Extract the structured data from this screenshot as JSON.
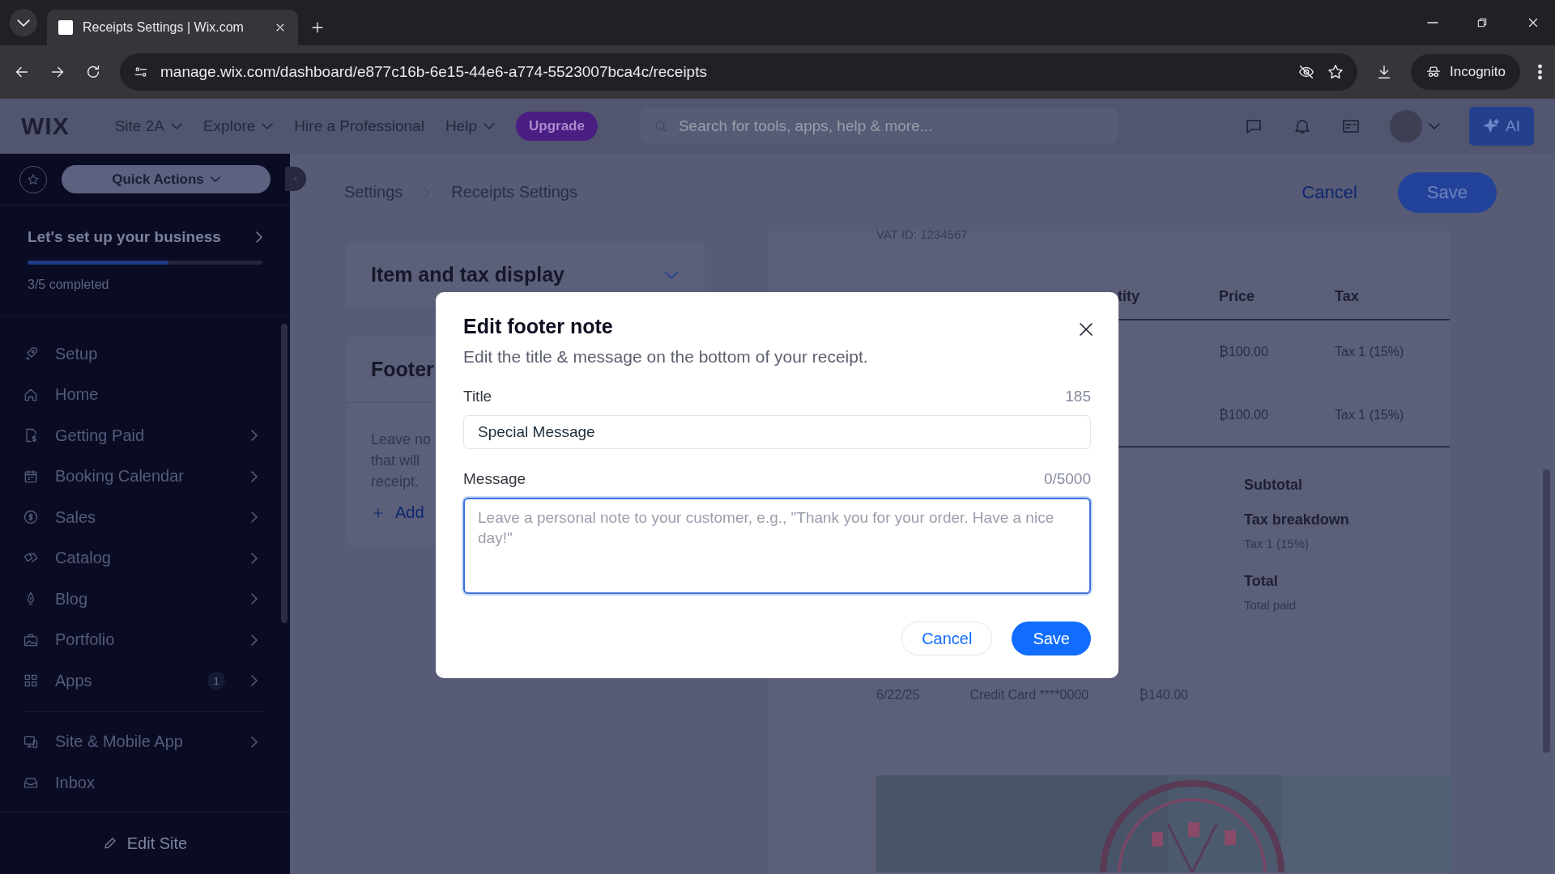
{
  "browser": {
    "tab_title": "Receipts Settings | Wix.com",
    "url": "manage.wix.com/dashboard/e877c16b-6e15-44e6-a774-5523007bca4c/receipts",
    "incognito": "Incognito"
  },
  "topbar": {
    "logo": "WIX",
    "menus": [
      {
        "label": "Site 2A",
        "dropdown": true
      },
      {
        "label": "Explore",
        "dropdown": true
      },
      {
        "label": "Hire a Professional",
        "dropdown": false
      },
      {
        "label": "Help",
        "dropdown": true
      }
    ],
    "upgrade": "Upgrade",
    "search_placeholder": "Search for tools, apps, help & more...",
    "ai": "AI"
  },
  "sidebar": {
    "quick_actions": "Quick Actions",
    "setup_title": "Let's set up your business",
    "setup_progress": {
      "level": 0.6
    },
    "setup_status": "3/5 completed",
    "items": [
      {
        "label": "Setup",
        "chevron": false
      },
      {
        "label": "Home",
        "chevron": false
      },
      {
        "label": "Getting Paid",
        "chevron": true
      },
      {
        "label": "Booking Calendar",
        "chevron": true
      },
      {
        "label": "Sales",
        "chevron": true
      },
      {
        "label": "Catalog",
        "chevron": true
      },
      {
        "label": "Blog",
        "chevron": true
      },
      {
        "label": "Portfolio",
        "chevron": true
      },
      {
        "label": "Apps",
        "chevron": true,
        "badge": "1"
      }
    ],
    "bottom_items": [
      {
        "label": "Site & Mobile App",
        "chevron": true
      },
      {
        "label": "Inbox",
        "chevron": false
      }
    ],
    "edit_site": "Edit Site"
  },
  "header": {
    "breadcrumbs": [
      "Settings",
      "Receipts Settings"
    ],
    "cancel": "Cancel",
    "save": "Save"
  },
  "settings": {
    "sections": [
      {
        "title": "Item and tax display"
      },
      {
        "title": "Footer",
        "lines": [
          "Leave no",
          "that will",
          "receipt."
        ],
        "add": "Add"
      }
    ]
  },
  "receipt": {
    "vat": "VAT ID: 1234567",
    "columns": [
      "tity",
      "Price",
      "Tax"
    ],
    "rows": [
      [
        "",
        "₿100.00",
        "Tax 1 (15%)"
      ],
      [
        "",
        "₿100.00",
        "Tax 1 (15%)"
      ]
    ],
    "summary": [
      {
        "label": "Subtotal"
      },
      {
        "label": "Tax breakdown",
        "note": "Tax 1 (15%)"
      },
      {
        "label": "Total",
        "note": "Total paid"
      }
    ],
    "payment": [
      "6/22/25",
      "Credit Card ****0000",
      "₿140.00"
    ]
  },
  "dialog": {
    "title": "Edit footer note",
    "subtitle": "Edit the title & message on the bottom of your receipt.",
    "fields": [
      {
        "label": "Title",
        "counter": "185",
        "value": "Special Message",
        "kind": "input",
        "focused": false
      },
      {
        "label": "Message",
        "counter": "0/5000",
        "placeholder": "Leave a personal note to your customer, e.g., \"Thank you for your order. Have a nice day!\"",
        "kind": "textarea",
        "focused": true
      }
    ],
    "cancel": "Cancel",
    "save": "Save"
  }
}
